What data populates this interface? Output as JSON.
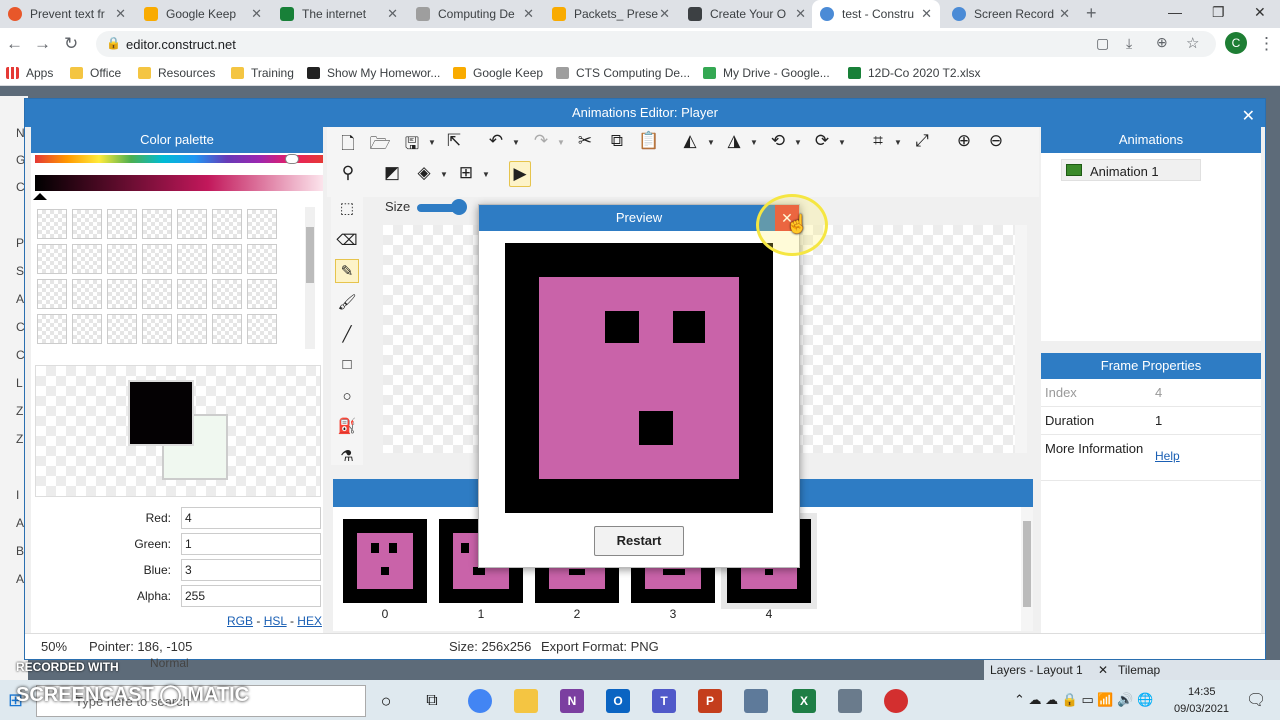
{
  "browser": {
    "tabs": [
      {
        "label": "Prevent text fr",
        "color": "#e8572a"
      },
      {
        "label": "Google Keep",
        "color": "#f9ab00"
      },
      {
        "label": "The internet",
        "color": "#188038"
      },
      {
        "label": "Computing De",
        "color": "#9e9e9e"
      },
      {
        "label": "Packets_ Prese",
        "color": "#f9ab00"
      },
      {
        "label": "Create Your O",
        "color": "#3c4043"
      },
      {
        "label": "test - Constru",
        "color": "#4b8bd6"
      },
      {
        "label": "Screen Record",
        "color": "#4b8bd6"
      }
    ],
    "url": "editor.construct.net",
    "avatar": "C",
    "bookmarks": [
      {
        "label": "Apps",
        "color": "#e53935"
      },
      {
        "label": "Office",
        "color": "#f4c542"
      },
      {
        "label": "Resources",
        "color": "#f4c542"
      },
      {
        "label": "Training",
        "color": "#f4c542"
      },
      {
        "label": "Show My Homewor...",
        "color": "#222222"
      },
      {
        "label": "Google Keep",
        "color": "#f9ab00"
      },
      {
        "label": "CTS Computing De...",
        "color": "#9e9e9e"
      },
      {
        "label": "My Drive - Google...",
        "color": "#34a853"
      },
      {
        "label": "12D-Co 2020 T2.xlsx",
        "color": "#188038"
      }
    ]
  },
  "dialog": {
    "title": "Animations Editor: Player",
    "close": "✕"
  },
  "palette": {
    "title": "Color palette",
    "red_label": "Red:",
    "red": "4",
    "green_label": "Green:",
    "green": "1",
    "blue_label": "Blue:",
    "blue": "3",
    "alpha_label": "Alpha:",
    "alpha": "255",
    "rgb": "RGB",
    "hsl": "HSL",
    "hex": "HEX",
    "sep": "-"
  },
  "toolbar": {
    "size_label": "Size"
  },
  "animations": {
    "title": "Animations",
    "items": [
      "Animation 1"
    ]
  },
  "frame_properties": {
    "title": "Frame Properties",
    "rows": [
      {
        "key": "Index",
        "value": "4"
      },
      {
        "key": "Duration",
        "value": "1"
      },
      {
        "key": "More Information",
        "value": "Help"
      }
    ]
  },
  "frames": [
    "0",
    "1",
    "2",
    "3",
    "4"
  ],
  "status": {
    "zoom": "50%",
    "pointer": "Pointer: 186, -105",
    "size": "Size: 256x256",
    "export": "Export Format: PNG"
  },
  "preview": {
    "title": "Preview",
    "close": "✕",
    "restart": "Restart",
    "face_color": "#c963a9"
  },
  "watermark": {
    "line1": "RECORDED WITH",
    "line2": "SCREENCAST ◯ MATIC"
  },
  "taskbar": {
    "search": "Type here to search",
    "time": "14:35",
    "date": "09/03/2021"
  },
  "bottom_tabs": {
    "layers": "Layers - Layout 1",
    "tilemap": "Tilemap",
    "normal": "Normal"
  },
  "left_strip_letters": [
    "N",
    "G",
    "C",
    "P",
    "S",
    "A",
    "C",
    "C",
    "L",
    "Z",
    "Z",
    "I",
    "A",
    "B",
    "A"
  ]
}
